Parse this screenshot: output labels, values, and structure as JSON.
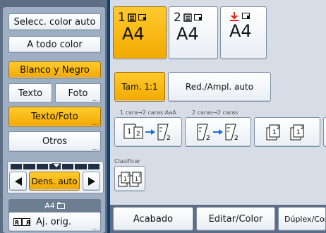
{
  "left": {
    "color_auto": "Selecc. color auto",
    "full_color": "A todo color",
    "black_white": "Blanco y Negro",
    "text": "Texto",
    "photo": "Foto",
    "text_photo": "Texto/Foto",
    "others": "Otros",
    "density_auto": "Dens. auto",
    "orig_size": "A4",
    "orig_settings": "Aj. orig."
  },
  "paper": {
    "tray1_num": "1",
    "tray1_size": "A4",
    "tray2_num": "2",
    "tray2_size": "A4",
    "bypass_size": "A4"
  },
  "reduce": {
    "full_size": "Tam. 1:1",
    "auto_reduce": "Red./Ampl. auto"
  },
  "duplex": {
    "label1": "1 cara→2 caras:AaA",
    "label2": "2 caras→2 caras"
  },
  "sort": {
    "label": "Clasificar"
  },
  "tabs": {
    "finishing": "Acabado",
    "edit_color": "Editar/Color",
    "duplex_combine": "Dúplex/Com"
  },
  "colors": {
    "accent": "#f2a900",
    "background": "#0b3f73",
    "panel": "#d6dde7"
  }
}
